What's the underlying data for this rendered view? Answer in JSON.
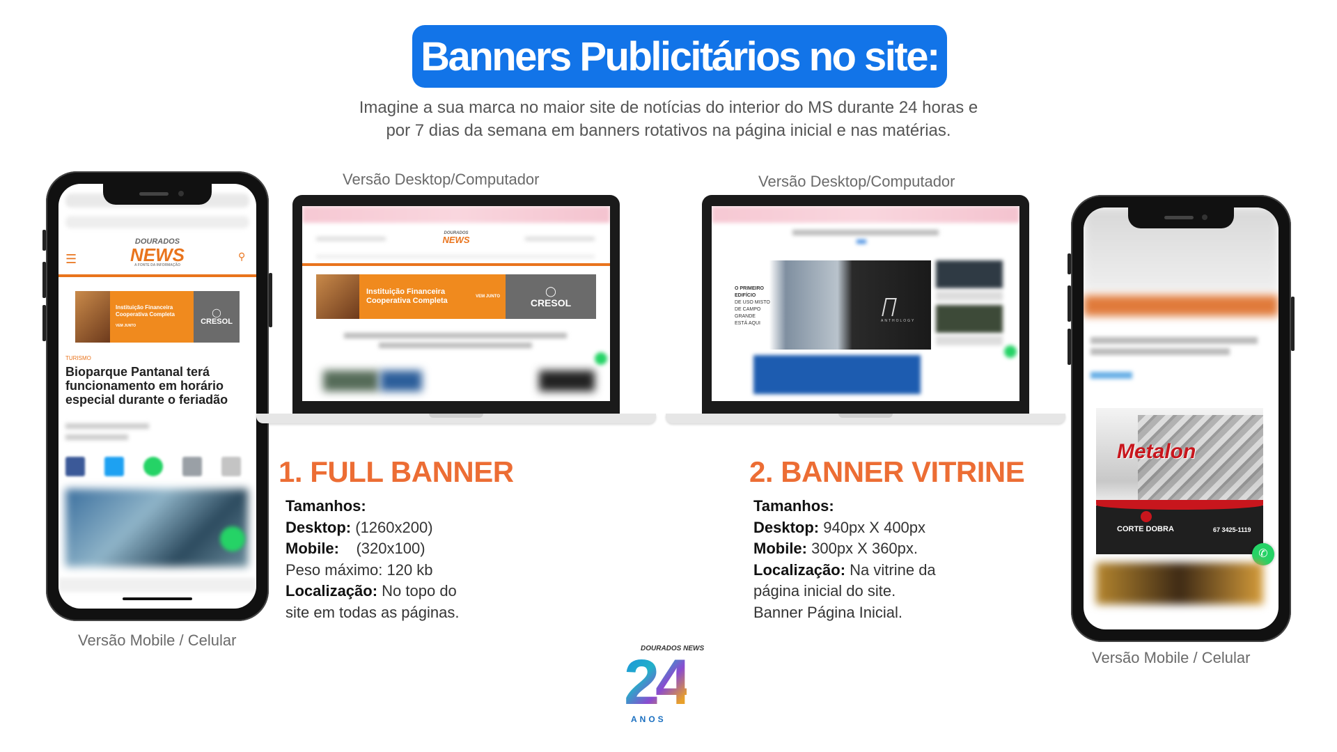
{
  "header": {
    "title": "Banners Publicitários no site:",
    "subtitle_line1": "Imagine a sua marca no maior site de notícias do interior do MS durante 24 horas e",
    "subtitle_line2": "por 7 dias da semana em banners rotativos na página inicial e nas matérias."
  },
  "captions": {
    "desktop_left": "Versão Desktop/Computador",
    "desktop_right": "Versão Desktop/Computador",
    "mobile_left": "Versão Mobile / Celular",
    "mobile_right": "Versão Mobile / Celular"
  },
  "full_banner": {
    "heading": "1. FULL BANNER",
    "sizes_label": "Tamanhos:",
    "desktop_label": "Desktop:",
    "desktop_value": " (1260x200)",
    "mobile_label": "Mobile:",
    "mobile_value": "    (320x100)",
    "weight": "Peso máximo: 120 kb",
    "location_label": "Localização:",
    "location_value": " No topo do",
    "location_line2": "site em todas as páginas."
  },
  "vitrine_banner": {
    "heading": "2. BANNER VITRINE",
    "sizes_label": "Tamanhos:",
    "desktop_label": "Desktop:",
    "desktop_value": " 940px X 400px",
    "mobile_label": "Mobile:",
    "mobile_value": " 300px X 360px.",
    "location_label": "Localização:",
    "location_value": " Na vitrine da",
    "location_line2": "página inicial do site.",
    "location_line3": "Banner Página Inicial."
  },
  "mockups": {
    "site_logo_top": "DOURADOS",
    "site_logo_main": "NEWS",
    "site_tagline": "A FONTE DA INFORMAÇÃO",
    "ad_text_line1": "Instituição Financeira",
    "ad_text_line2": "Cooperativa Completa",
    "ad_small": "VEM JUNTO",
    "ad_brand": "CRESOL",
    "article_category": "TURISMO",
    "article_title": "Bioparque Pantanal terá funcionamento em horário especial durante o feriadão",
    "vitrine_ad_line1": "O PRIMEIRO",
    "vitrine_ad_line2": "EDIFÍCIO",
    "vitrine_ad_line3": "DE USO MISTO",
    "vitrine_ad_line4": "DE CAMPO",
    "vitrine_ad_line5": "GRANDE",
    "vitrine_ad_line6": "ESTÁ AQUI",
    "vitrine_brand": "ANTHOLOGY",
    "mobile_ad_brand": "Metalon",
    "mobile_ad_store": "CORTE DOBRA",
    "mobile_ad_phone": "67 3425-1119"
  },
  "footer_logo": {
    "brand": "DOURADOS NEWS",
    "years": "24",
    "years_label": "ANOS"
  },
  "colors": {
    "title_blue": "#1274e8",
    "heading_orange": "#ec6d34",
    "brand_orange": "#e9741d"
  }
}
